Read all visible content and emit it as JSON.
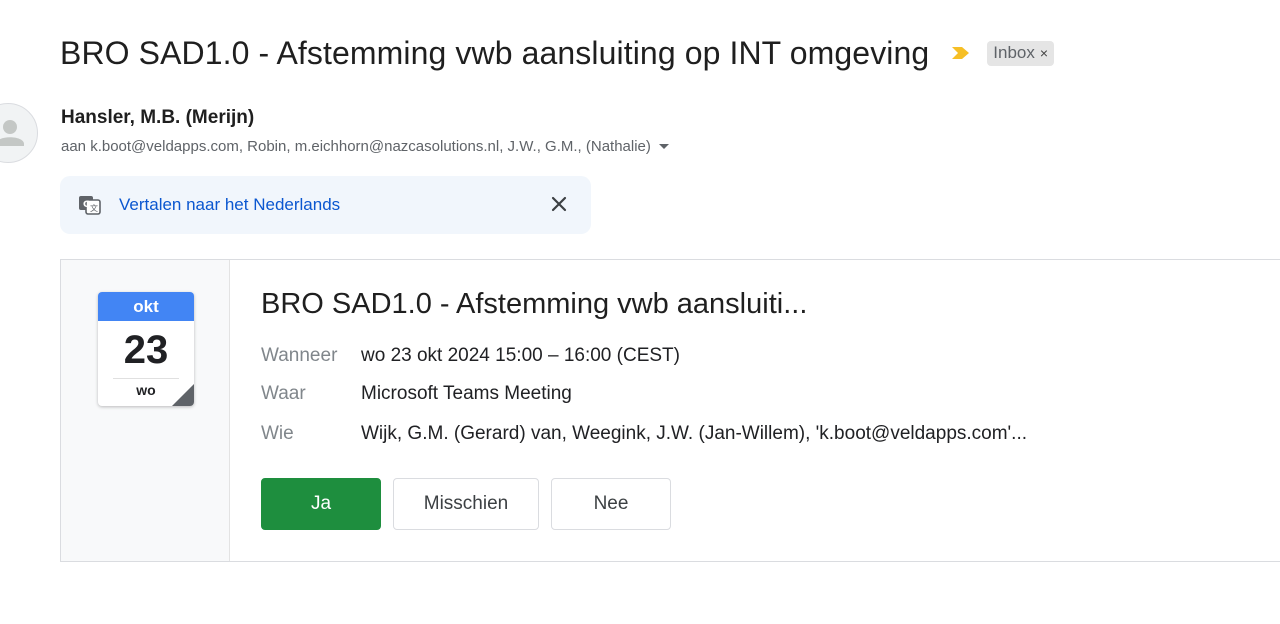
{
  "email": {
    "subject": "BRO SAD1.0 - Afstemming vwb aansluiting op INT omgeving",
    "label": "Inbox",
    "label_remove": "×",
    "sender": "Hansler, M.B. (Merijn)",
    "recipients": "aan k.boot@veldapps.com, Robin, m.eichhorn@nazcasolutions.nl, J.W., G.M., (Nathalie)"
  },
  "translate": {
    "link": "Vertalen naar het Nederlands"
  },
  "invite": {
    "month": "okt",
    "day": "23",
    "weekday": "wo",
    "title": "BRO SAD1.0 - Afstemming vwb aansluiti...",
    "details": [
      {
        "key": "Wanneer",
        "value": "wo 23 okt 2024 15:00 – 16:00 (CEST)"
      },
      {
        "key": "Waar",
        "value": "Microsoft Teams Meeting"
      },
      {
        "key": "Wie",
        "value": "Wijk, G.M. (Gerard) van, Weegink, J.W. (Jan-Willem), 'k.boot@veldapps.com'..."
      }
    ],
    "rsvp": {
      "yes": "Ja",
      "maybe": "Misschien",
      "no": "Nee"
    }
  },
  "colors": {
    "importance": "#f6bf26",
    "calendar_header": "#4285f4",
    "yes_button": "#1e8e3e",
    "translate_link": "#0b57d0"
  },
  "icons": [
    "importance-marker-icon",
    "avatar-person-icon",
    "translate-icon",
    "close-icon",
    "calendar-icon"
  ]
}
